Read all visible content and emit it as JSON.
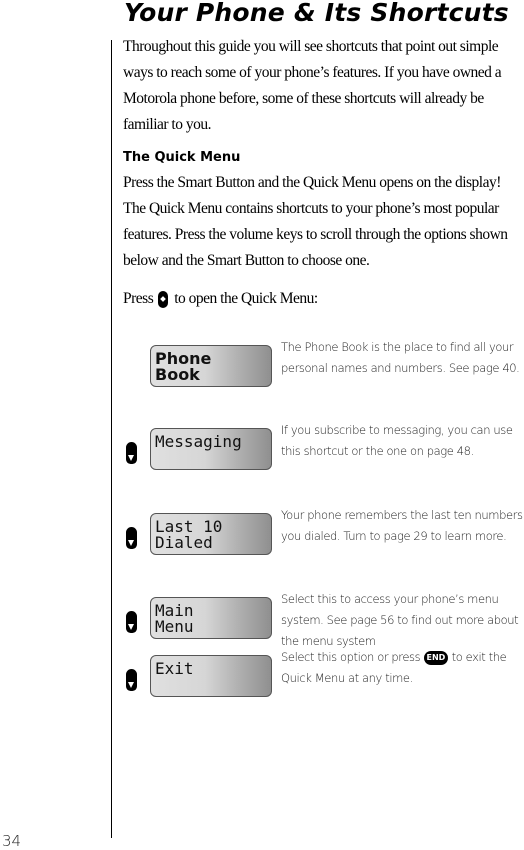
{
  "page": {
    "title": "Your Phone & Its Shortcuts",
    "intro": "Throughout this guide you will see shortcuts that point out simple ways to reach some of your phone’s features. If you have owned a Motorola phone before, some of these shortcuts will already be familiar to you.",
    "quick_menu": {
      "heading": "The Quick Menu",
      "body": "Press the Smart Button and the Quick Menu opens on the display! The Quick Menu contains shortcuts to your phone’s most popular features. Press the volume keys to scroll through the options shown below and the Smart Button to choose one.",
      "press_prefix": "Press",
      "press_key_icon": "smart-button-icon",
      "press_suffix": "to open the Quick Menu:"
    },
    "items": [
      {
        "display_line1": "Phone",
        "display_line2": "Book",
        "has_scroll_key": false,
        "description": "The Phone Book is the place to find all your personal names and numbers. See page 40."
      },
      {
        "display_line1": "Messaging",
        "display_line2": "",
        "has_scroll_key": true,
        "description": "If you subscribe to messaging, you can use this shortcut or the one on page 48."
      },
      {
        "display_line1": "Last 10",
        "display_line2": "Dialed",
        "has_scroll_key": true,
        "description": "Your phone remembers the last ten numbers you dialed. Turn to page 29 to learn more."
      },
      {
        "display_line1": "Main",
        "display_line2": "Menu",
        "has_scroll_key": true,
        "description": "Select this to access your phone’s menu system. See page 56 to find out more about the menu system"
      },
      {
        "display_line1": "Exit",
        "display_line2": "",
        "has_scroll_key": true,
        "description_prefix": "Select this option or press",
        "end_key_label": "END",
        "description_suffix": "to exit the Quick Menu at any time."
      }
    ],
    "page_number": "34"
  }
}
